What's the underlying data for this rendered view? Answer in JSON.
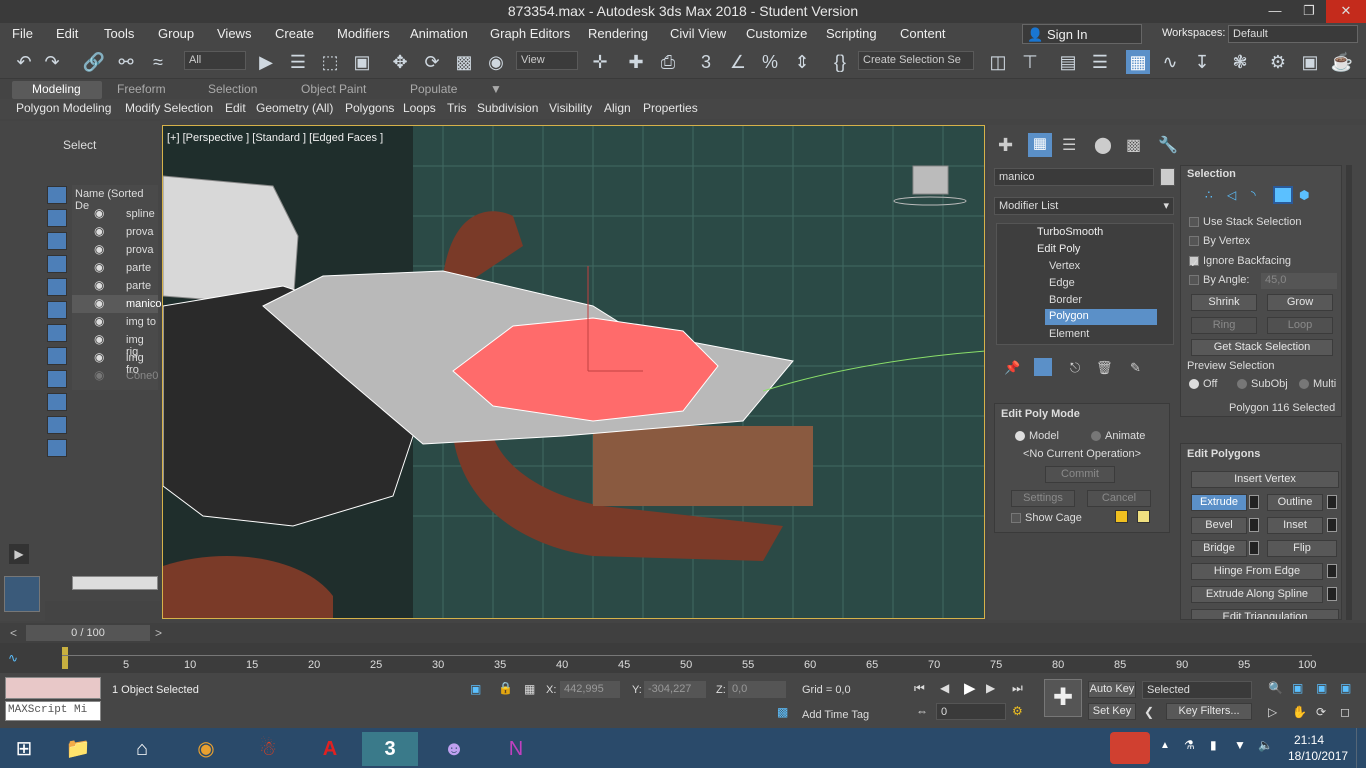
{
  "window": {
    "title": "873354.max - Autodesk 3ds Max 2018 - Student Version"
  },
  "menu": [
    "File",
    "Edit",
    "Tools",
    "Group",
    "Views",
    "Create",
    "Modifiers",
    "Animation",
    "Graph Editors",
    "Rendering",
    "Civil View",
    "Customize",
    "Scripting",
    "Content"
  ],
  "account": {
    "sign_in": "Sign In",
    "workspaces_label": "Workspaces:",
    "workspace": "Default"
  },
  "toolbar": {
    "filter": "All",
    "view": "View",
    "selection_set": "Create Selection Se"
  },
  "ribbon": {
    "tabs": [
      "Modeling",
      "Freeform",
      "Selection",
      "Object Paint",
      "Populate"
    ],
    "active": "Modeling",
    "items": [
      "Polygon Modeling",
      "Modify Selection",
      "Edit",
      "Geometry (All)",
      "Polygons",
      "Loops",
      "Tris",
      "Subdivision",
      "Visibility",
      "Align",
      "Properties"
    ]
  },
  "scene": {
    "title": "Select",
    "header": "Name (Sorted De",
    "items": [
      "spline",
      "prova",
      "prova",
      "parte",
      "parte",
      "manico",
      "img to",
      "img rig",
      "img fro",
      "Cone0"
    ]
  },
  "viewport": {
    "label": "[+] [Perspective ] [Standard ] [Edged Faces ]"
  },
  "panel": {
    "object_name": "manico",
    "modifier_list": "Modifier List",
    "stack": [
      "TurboSmooth",
      "Edit Poly",
      "Vertex",
      "Edge",
      "Border",
      "Polygon",
      "Element"
    ],
    "selection": {
      "title": "Selection",
      "use_stack": "Use Stack Selection",
      "by_vertex": "By Vertex",
      "ignore_backfacing": "Ignore Backfacing",
      "by_angle": "By Angle:",
      "angle_value": "45,0",
      "shrink": "Shrink",
      "grow": "Grow",
      "ring": "Ring",
      "loop": "Loop",
      "get_stack": "Get Stack Selection",
      "preview": "Preview Selection",
      "off": "Off",
      "subobj": "SubObj",
      "multi": "Multi",
      "status": "Polygon 116 Selected"
    },
    "edit_poly_mode": {
      "title": "Edit Poly Mode",
      "model": "Model",
      "animate": "Animate",
      "current_op": "<No Current Operation>",
      "commit": "Commit",
      "settings": "Settings",
      "cancel": "Cancel",
      "show_cage": "Show Cage"
    },
    "edit_polygons": {
      "title": "Edit Polygons",
      "insert_vertex": "Insert Vertex",
      "extrude": "Extrude",
      "outline": "Outline",
      "bevel": "Bevel",
      "inset": "Inset",
      "bridge": "Bridge",
      "flip": "Flip",
      "hinge": "Hinge From Edge",
      "extrude_spline": "Extrude Along Spline",
      "edit_tri": "Edit Triangulation"
    }
  },
  "timeline": {
    "frame": "0 / 100",
    "ticks": [
      "5",
      "10",
      "15",
      "20",
      "25",
      "30",
      "35",
      "40",
      "45",
      "50",
      "55",
      "60",
      "65",
      "70",
      "75",
      "80",
      "85",
      "90",
      "95",
      "100"
    ]
  },
  "status": {
    "script": "MAXScript Mi",
    "selected": "1 Object Selected",
    "x_label": "X:",
    "x": "442,995",
    "y_label": "Y:",
    "y": "-304,227",
    "z_label": "Z:",
    "z": "0,0",
    "grid": "Grid = 0,0",
    "add_time_tag": "Add Time Tag",
    "auto_key": "Auto Key",
    "set_key": "Set Key",
    "key_mode": "Selected",
    "key_filters": "Key Filters...",
    "frame_field": "0"
  },
  "taskbar": {
    "time": "21:14",
    "date": "18/10/2017"
  },
  "colors": {
    "selected_face": "#ff6b6b",
    "accent": "#5b90c8",
    "viewport_bg": "#2b4a46"
  }
}
